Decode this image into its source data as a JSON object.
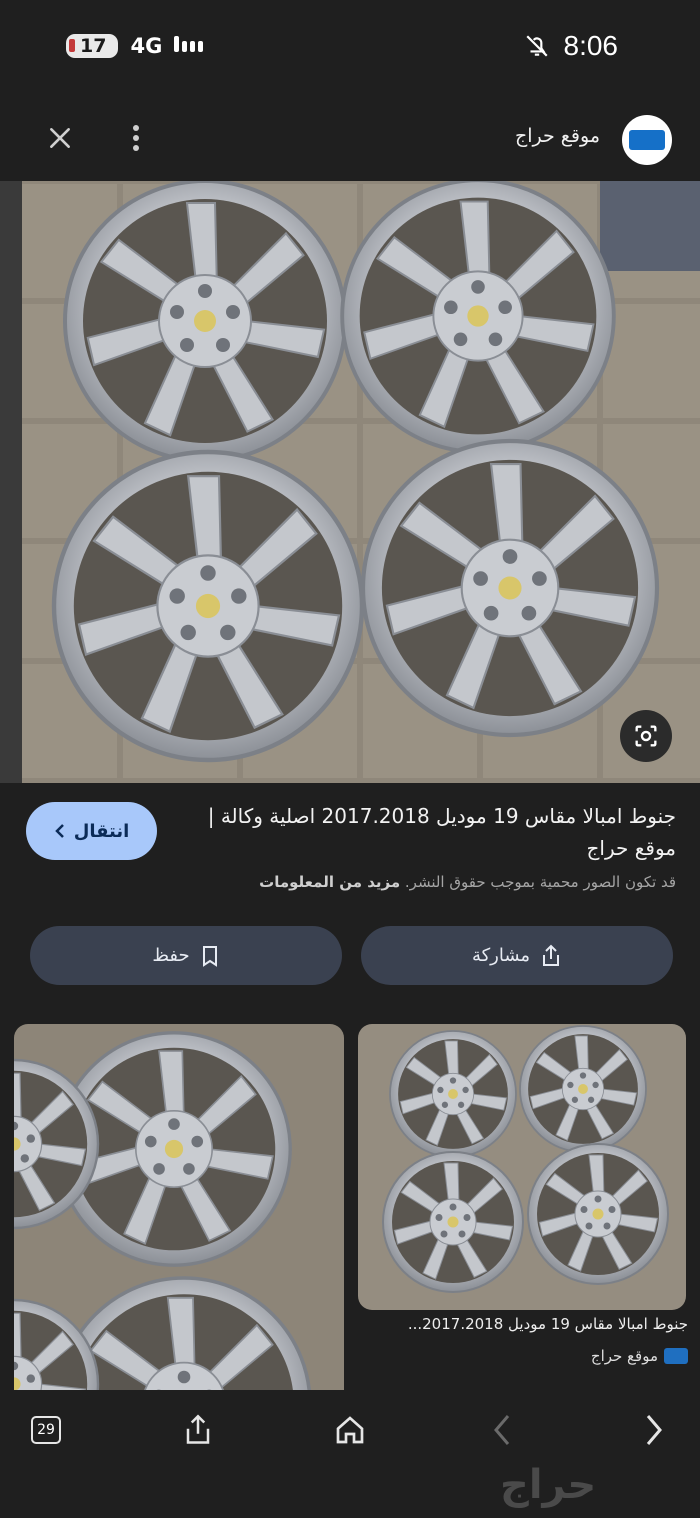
{
  "status": {
    "badge": "17",
    "network": "4G",
    "time": "8:06"
  },
  "header": {
    "site_name": "موقع حراج"
  },
  "main": {
    "title": "جنوط امبالا مقاس 19 موديل 2017.2018 اصلية وكالة | موقع حراج",
    "copyright_text": "قد تكون الصور محمية بموجب حقوق النشر. ",
    "more_info": "مزيد من المعلومات",
    "visit_label": "انتقال",
    "save_label": "حفظ",
    "share_label": "مشاركة"
  },
  "related": {
    "title": "جنوط امبالا مقاس 19 موديل 2017.2018...",
    "source": "موقع حراج"
  },
  "bottom": {
    "tab_count": "29",
    "watermark": "حراج"
  },
  "colors": {
    "background": "#1f1f1f",
    "visit_button": "#a8c8fa",
    "action_button": "#3a4150"
  }
}
